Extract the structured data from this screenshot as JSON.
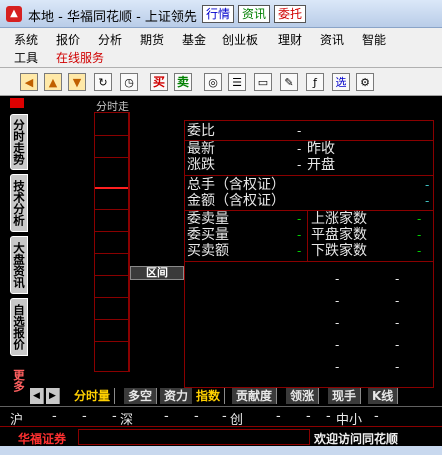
{
  "window": {
    "title": "本地 - 华福同花顺 - 上证领先",
    "quick_buttons": {
      "quote": "行情",
      "news": "资讯",
      "trade": "委托"
    }
  },
  "menu": {
    "row1": [
      "系统",
      "报价",
      "分析",
      "期货",
      "基金",
      "创业板",
      "理财",
      "资讯",
      "智能"
    ],
    "row2": [
      "工具",
      "在线服务"
    ]
  },
  "toolbar": {
    "buy_label": "买",
    "sell_label": "卖",
    "select_label": "选"
  },
  "left_tabs": [
    "分时走势",
    "技术分析",
    "大盘资讯",
    "自选报价",
    "更多"
  ],
  "chart": {
    "title": "分时走"
  },
  "section_button": "区间",
  "quote": {
    "weibi": "委比",
    "latest": "最新",
    "change": "涨跌",
    "prev_close": "昨收",
    "open": "开盘",
    "volume": "总手（含权证）",
    "amount": "金额（含权证）",
    "sell_vol": "委卖量",
    "buy_vol": "委买量",
    "buysell_amount": "买卖额",
    "up_count": "上涨家数",
    "flat_count": "平盘家数",
    "down_count": "下跌家数",
    "dash": "-"
  },
  "bottom_tabs": [
    "分时量",
    "多空",
    "资力",
    "指数",
    "贡献度",
    "领涨",
    "现手",
    "K线"
  ],
  "index_strip": {
    "sh": "沪",
    "sz": "深",
    "cy": "创",
    "zx": "中小",
    "dash": "-"
  },
  "status": {
    "logo": "华福证券",
    "message": "欢迎访问同花顺"
  }
}
